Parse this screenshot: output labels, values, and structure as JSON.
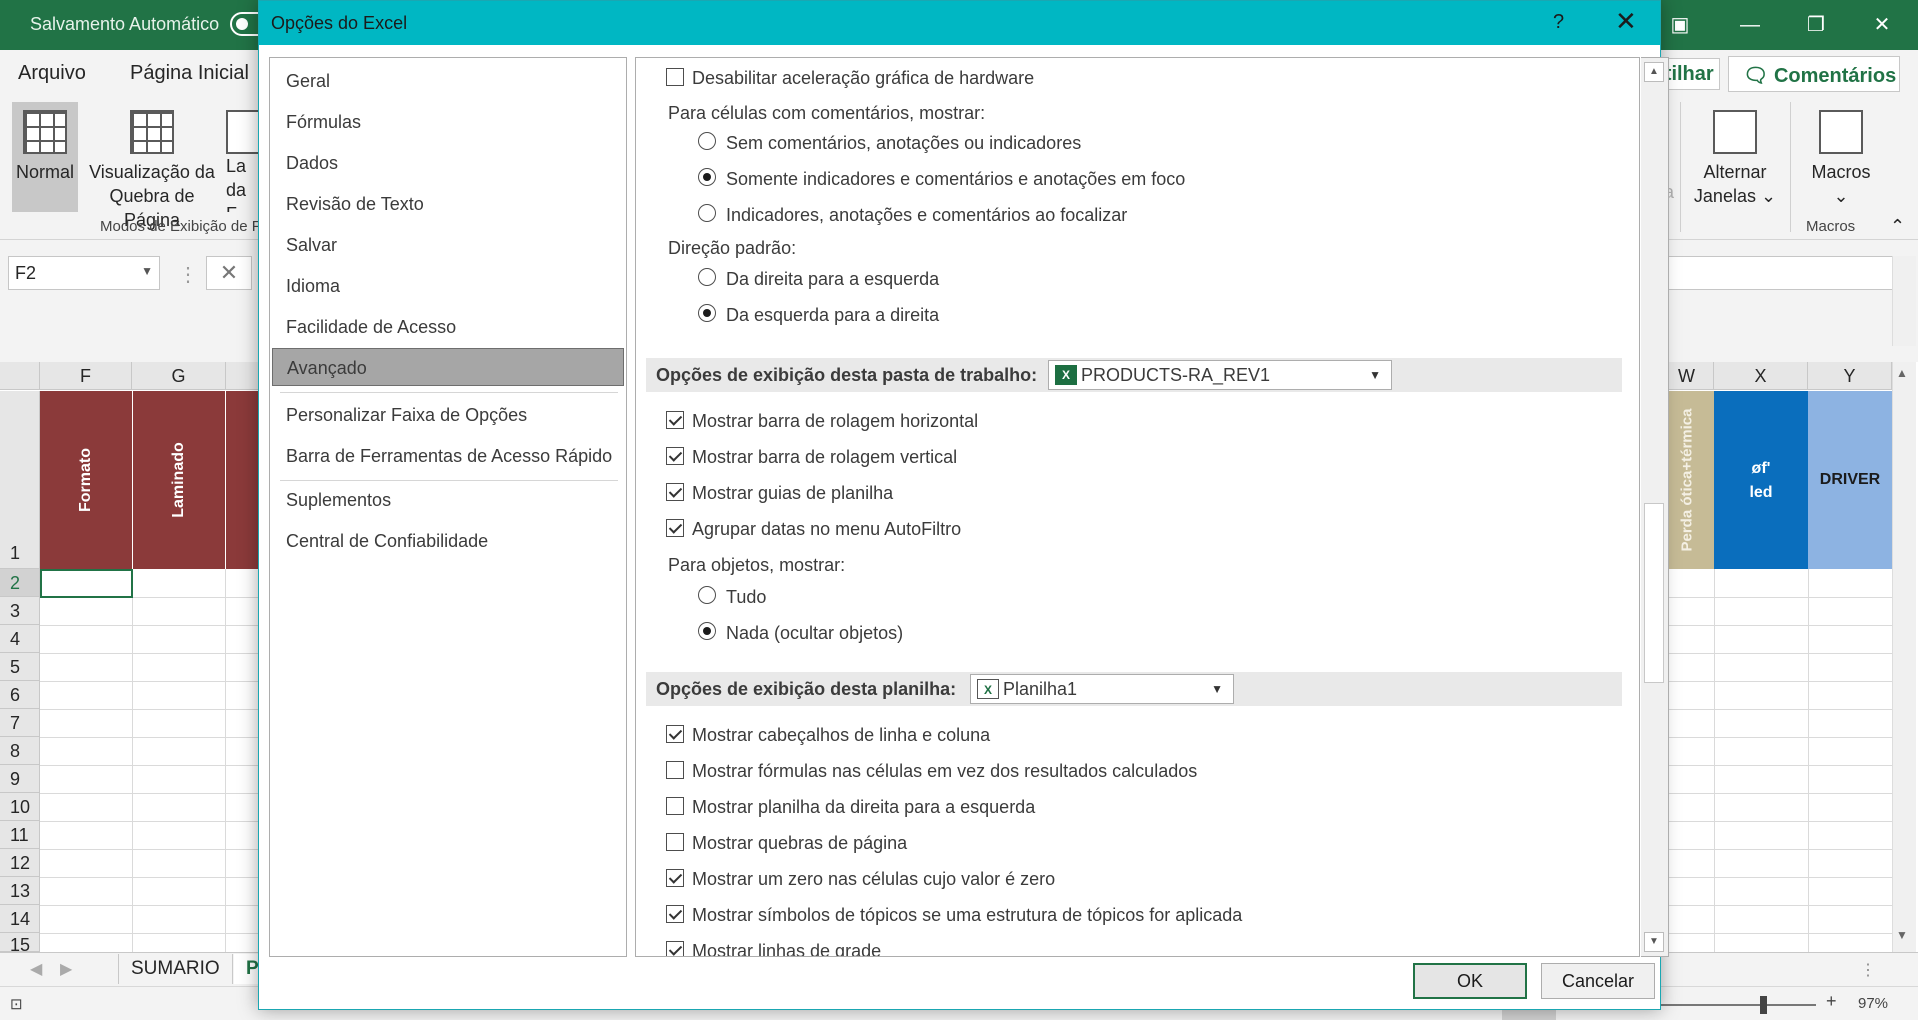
{
  "excel": {
    "autosave_label": "Salvamento Automático",
    "menu": [
      "Arquivo",
      "Página Inicial"
    ],
    "share_label": "rtilhar",
    "comments_label": "Comentários",
    "ribbon": {
      "normal": "Normal",
      "page_break_line1": "Visualização da",
      "page_break_line2": "Quebra de Página",
      "partial_line1": "La",
      "partial_line2": "da F",
      "group_label": "Modos de Exibição de P",
      "switch_windows_line1": "Alternar",
      "switch_windows_line2": "Janelas",
      "macros": "Macros",
      "macros_group": "Macros",
      "faded": "la"
    },
    "name_box": "F2",
    "columns_left": [
      "F",
      "G"
    ],
    "columns_right": [
      "W",
      "X",
      "Y"
    ],
    "header_cells": {
      "f": "Formato",
      "g": "Laminado",
      "w": "Perda ótica+térmica",
      "x_line1": "øf'",
      "x_line2": "led",
      "y": "DRIVER"
    },
    "rows": [
      "1",
      "2",
      "3",
      "4",
      "5",
      "6",
      "7",
      "8",
      "9",
      "10",
      "11",
      "12",
      "13",
      "14",
      "15"
    ],
    "sheet_tabs": [
      "SUMARIO",
      "P"
    ],
    "zoom": "97%",
    "colors": {
      "green": "#217346",
      "maroon": "#8b3a3a",
      "tan": "#c6bb96",
      "blue": "#0a6ebd",
      "lightblue": "#8db3e2"
    }
  },
  "dialog": {
    "title": "Opções do Excel",
    "help": "?",
    "close": "✕",
    "nav": [
      "Geral",
      "Fórmulas",
      "Dados",
      "Revisão de Texto",
      "Salvar",
      "Idioma",
      "Facilidade de Acesso",
      "Avançado",
      "Personalizar Faixa de Opções",
      "Barra de Ferramentas de Acesso Rápido",
      "Suplementos",
      "Central de Confiabilidade"
    ],
    "selected_nav": "Avançado",
    "options": {
      "disable_hw_accel": "Desabilitar aceleração gráfica de hardware",
      "comments_header": "Para células com comentários, mostrar:",
      "no_comments": "Sem comentários, anotações ou indicadores",
      "indicators_only": "Somente indicadores e comentários e anotações em foco",
      "indicators_hover": "Indicadores, anotações e comentários ao focalizar",
      "direction_header": "Direção padrão:",
      "right_to_left": "Da direita para a esquerda",
      "left_to_right": "Da esquerda para a direita",
      "workbook_section": "Opções de exibição desta pasta de trabalho:",
      "workbook_name": "PRODUCTS-RA_REV1",
      "show_hscroll": "Mostrar barra de rolagem horizontal",
      "show_vscroll": "Mostrar barra de rolagem vertical",
      "show_sheet_tabs": "Mostrar guias de planilha",
      "group_dates": "Agrupar datas no menu AutoFiltro",
      "objects_header": "Para objetos, mostrar:",
      "all": "Tudo",
      "nothing": "Nada (ocultar objetos)",
      "sheet_section": "Opções de exibição desta planilha:",
      "sheet_name": "Planilha1",
      "show_headers": "Mostrar cabeçalhos de linha e coluna",
      "show_formulas": "Mostrar fórmulas nas células em vez dos resultados calculados",
      "show_rtl": "Mostrar planilha da direita para a esquerda",
      "show_page_breaks": "Mostrar quebras de página",
      "show_zero": "Mostrar um zero nas células cujo valor é zero",
      "show_outline": "Mostrar símbolos de tópicos se uma estrutura de tópicos for aplicada",
      "show_gridlines": "Mostrar linhas de grade"
    },
    "ok": "OK",
    "cancel": "Cancelar"
  }
}
